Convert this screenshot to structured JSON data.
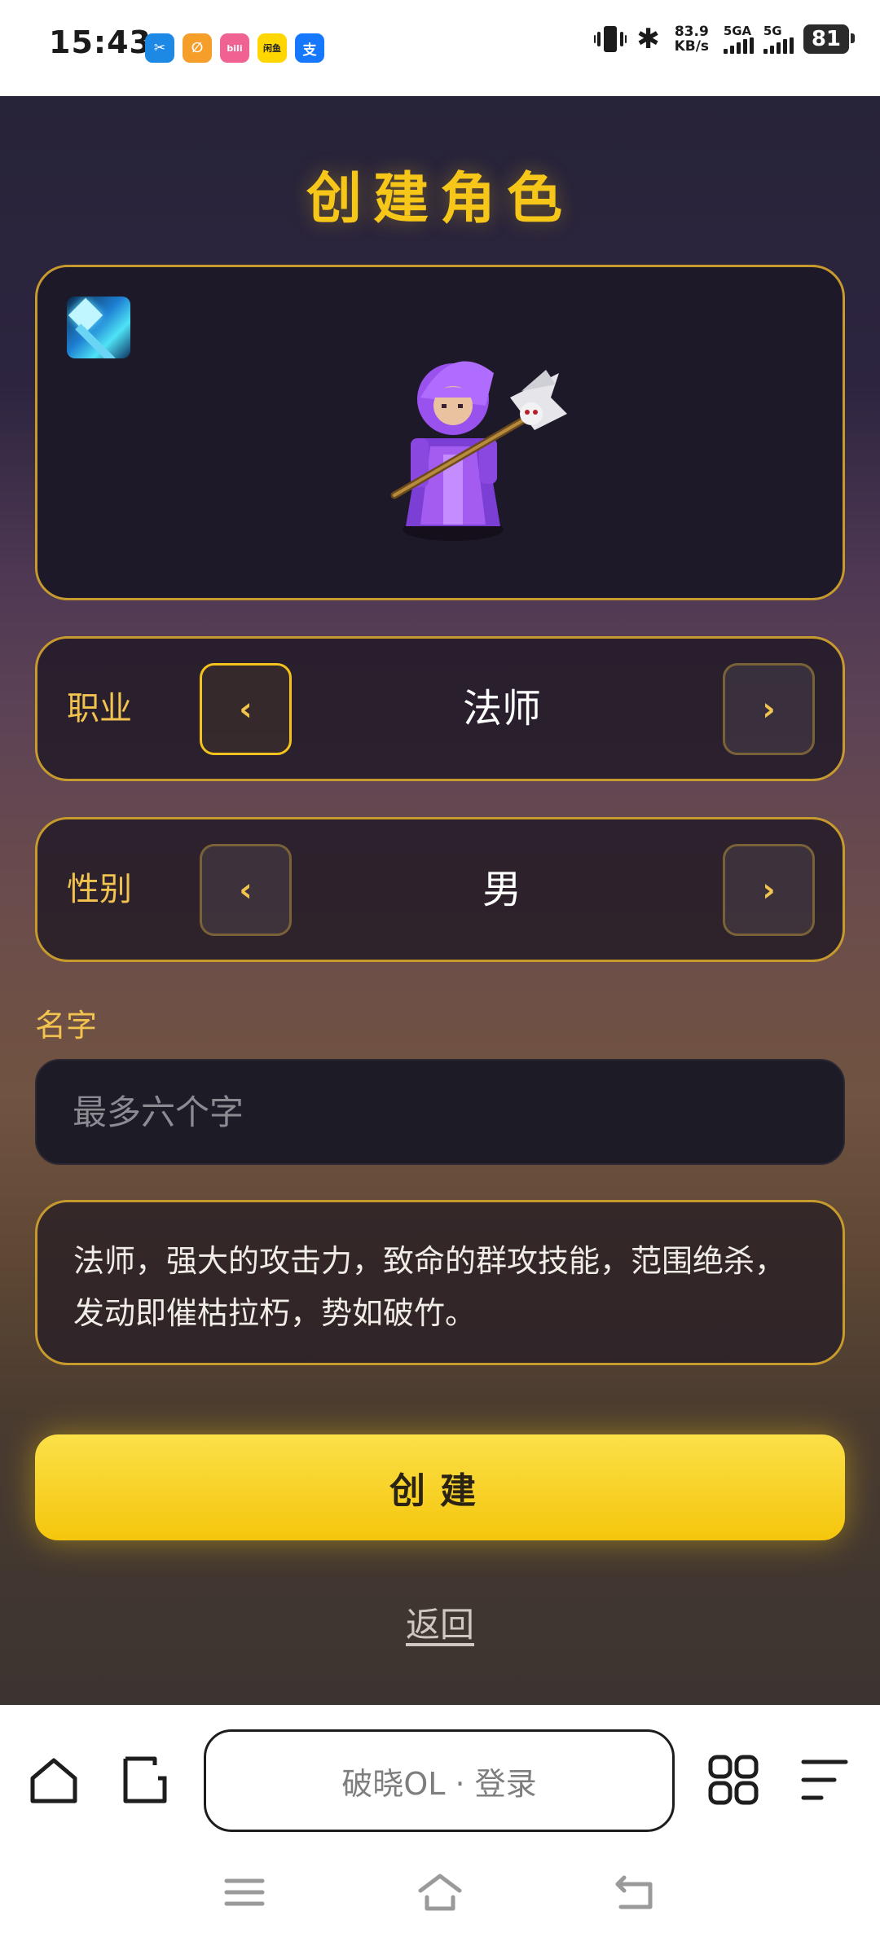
{
  "status_bar": {
    "time": "15:43",
    "net_speed_value": "83.9",
    "net_speed_unit": "KB/s",
    "sim1_label": "5GA",
    "sim2_label": "5G",
    "battery": "81",
    "app_icons": [
      {
        "name": "app-icon-1",
        "color": "#1e88e5",
        "glyph": "✂"
      },
      {
        "name": "app-icon-2",
        "color": "#f59e2a",
        "glyph": "∅"
      },
      {
        "name": "app-icon-3",
        "color": "#f06292",
        "glyph": "bili"
      },
      {
        "name": "app-icon-4",
        "color": "#ffd600",
        "glyph": "闲鱼"
      },
      {
        "name": "alipay-icon",
        "color": "#1677ff",
        "glyph": "支"
      }
    ]
  },
  "page": {
    "title": "创建角色",
    "class_row": {
      "label": "职业",
      "value": "法师",
      "prev": "‹",
      "next": "›"
    },
    "gender_row": {
      "label": "性别",
      "value": "男",
      "prev": "‹",
      "next": "›"
    },
    "name": {
      "label": "名字",
      "placeholder": "最多六个字",
      "value": ""
    },
    "description": "法师，强大的攻击力，致命的群攻技能，范围绝杀，发动即催枯拉朽，势如破竹。",
    "create_button": "创建",
    "back_link": "返回"
  },
  "browser": {
    "url_text": "破晓OL · 登录"
  },
  "colors": {
    "accent_gold": "#f6c619",
    "button_yellow": "#f5c60c",
    "panel_border": "#c79a2e"
  }
}
